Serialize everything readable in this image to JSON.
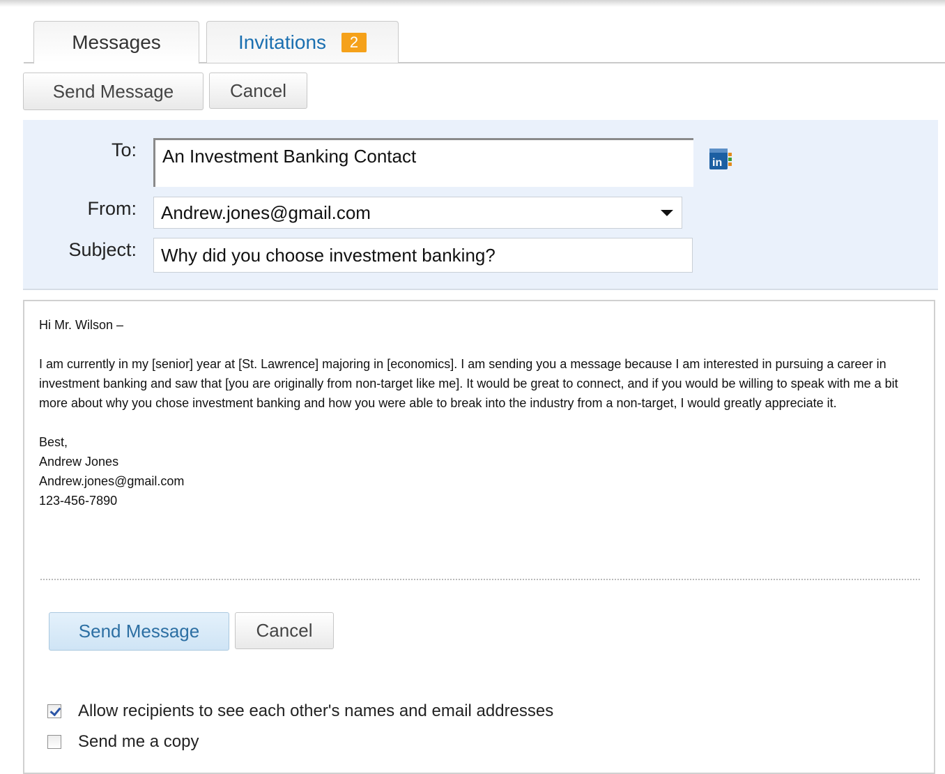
{
  "tabs": {
    "messages_label": "Messages",
    "invitations_label": "Invitations",
    "invitations_badge": "2"
  },
  "toolbar": {
    "send_label": "Send Message",
    "cancel_label": "Cancel"
  },
  "compose": {
    "to_label": "To:",
    "to_value": "An Investment Banking Contact",
    "from_label": "From:",
    "from_value": "Andrew.jones@gmail.com",
    "subject_label": "Subject:",
    "subject_value": "Why did you choose investment banking?"
  },
  "message": {
    "greeting": "Hi Mr. Wilson –",
    "paragraph": "I am currently in my [senior] year at [St. Lawrence] majoring in [economics]. I am sending you a message because I am interested in pursuing a career in investment banking and saw that [you are originally from non-target like me]. It would be great to connect, and if you would be willing to speak with me a bit more about why you chose investment banking and how you were able to break into the industry from a non-target, I would greatly appreciate it.",
    "signoff": "Best,",
    "name": "Andrew Jones",
    "email": "Andrew.jones@gmail.com",
    "phone": "123-456-7890"
  },
  "footer": {
    "send_label": "Send Message",
    "cancel_label": "Cancel",
    "allow_recipients_label": "Allow recipients to see each other's names and email addresses",
    "allow_recipients_checked": true,
    "send_copy_label": "Send me a copy",
    "send_copy_checked": false
  },
  "icons": {
    "address_book": "linkedin-address-book-icon"
  },
  "colors": {
    "accent": "#1a6fb0",
    "badge": "#f5a11a",
    "header_bg": "#eaf1fb"
  }
}
